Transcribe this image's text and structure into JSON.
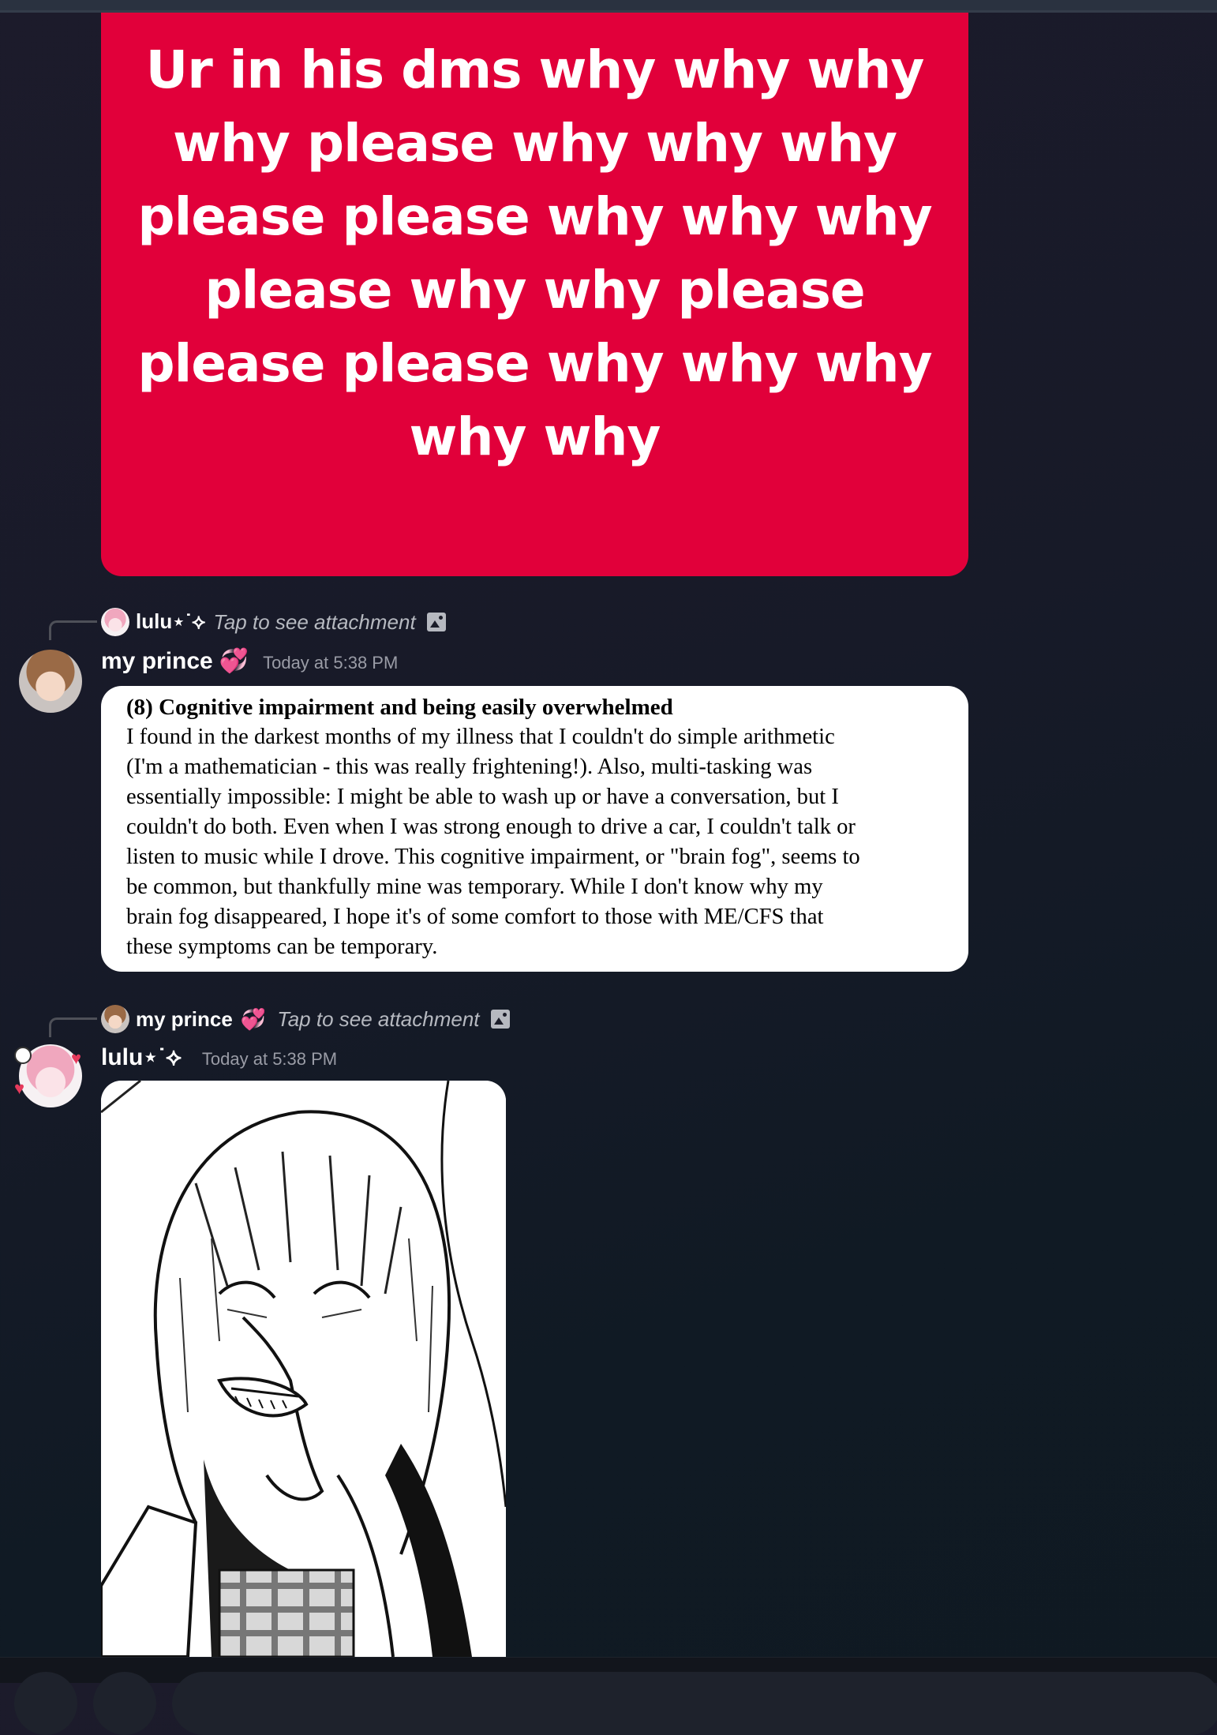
{
  "red_image": {
    "lines": [
      "Ur in his dms why why why",
      "why please why why why",
      "please please why why why",
      "please why why please",
      "please please why why why",
      "why why"
    ],
    "color": "#e1003a"
  },
  "message1": {
    "reply": {
      "name": "lulu⋆˙⟡",
      "hint": "Tap to see attachment",
      "icon": "image-icon"
    },
    "author": "my prince",
    "badge_icon": "heart-icon",
    "timestamp": "Today at 5:38 PM",
    "doc": {
      "heading": "(8) Cognitive impairment and being easily overwhelmed",
      "lines": [
        "I found in the darkest months of my illness that I couldn't do simple arithmetic",
        "(I'm a mathematician - this was really frightening!). Also, multi-tasking was",
        "essentially impossible: I might be able to wash up or have a conversation, but I",
        "couldn't do both. Even when I was strong enough to drive a car, I couldn't talk or",
        "listen to music while I drove. This cognitive impairment, or \"brain fog\", seems to",
        "be common, but thankfully mine was temporary. While I don't know why my",
        "brain fog disappeared, I hope it's of some comfort to those with ME/CFS that",
        "these symptoms can be temporary."
      ]
    }
  },
  "message2": {
    "reply": {
      "name": "my prince",
      "hint": "Tap to see attachment",
      "icon": "image-icon"
    },
    "author": "lulu⋆˙⟡",
    "timestamp": "Today at 5:38 PM",
    "attachment": "manga-image"
  },
  "colors": {
    "accent_heart": "#f06ab4",
    "timestamp": "#9a9ca6",
    "reply_hint": "#b6b9c0"
  }
}
